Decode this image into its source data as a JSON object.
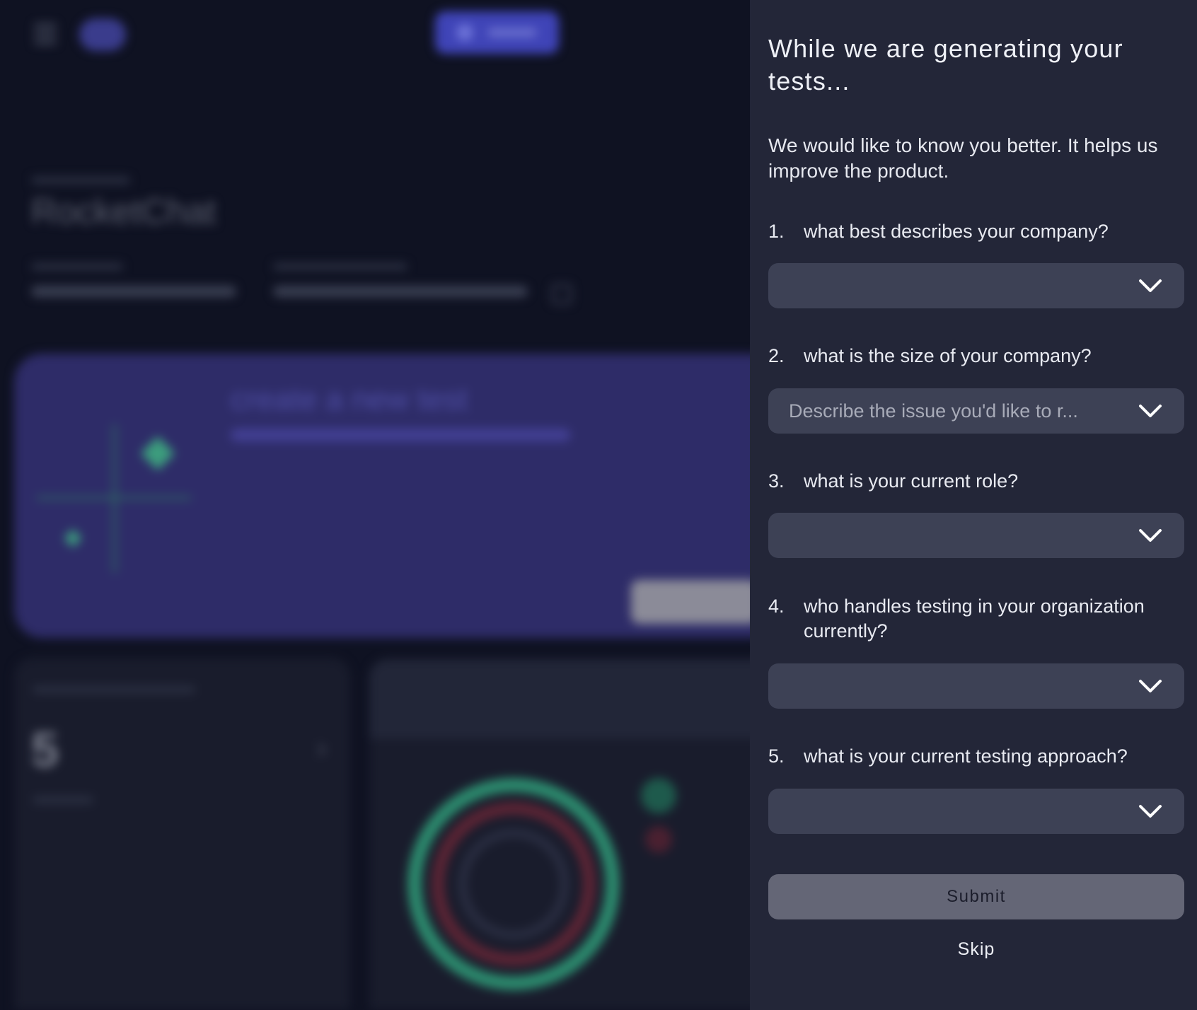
{
  "background": {
    "project_title": "RocketChat",
    "banner_title": "create a new test",
    "active_count": "5"
  },
  "panel": {
    "title": "While we are generating your tests...",
    "intro": "We would like to know you better. It helps us improve the product.",
    "questions": [
      {
        "number": "1.",
        "text": "what best describes your company?",
        "placeholder": ""
      },
      {
        "number": "2.",
        "text": "what is the size of your company?",
        "placeholder": "Describe the issue you'd like to r..."
      },
      {
        "number": "3.",
        "text": "what is your current role?",
        "placeholder": ""
      },
      {
        "number": "4.",
        "text": "who handles testing in your organization currently?",
        "placeholder": ""
      },
      {
        "number": "5.",
        "text": "what is your current testing approach?",
        "placeholder": ""
      }
    ],
    "submit_label": "Submit",
    "skip_label": "Skip"
  }
}
